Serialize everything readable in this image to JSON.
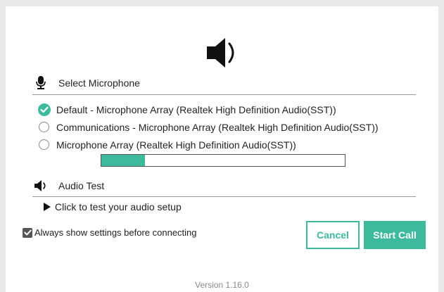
{
  "dialog": {
    "speaker_icon": "speaker-volume-icon"
  },
  "microphone": {
    "header": "Select Microphone",
    "icon": "microphone-icon",
    "options": [
      {
        "label": "Default - Microphone Array (Realtek High Definition Audio(SST))",
        "selected": true
      },
      {
        "label": "Communications - Microphone Array (Realtek High Definition Audio(SST))",
        "selected": false
      },
      {
        "label": "Microphone Array (Realtek High Definition Audio(SST))",
        "selected": false
      }
    ],
    "level": 0.18
  },
  "audio_test": {
    "header": "Audio Test",
    "icon": "speaker-icon",
    "test_link": "Click to test your audio setup"
  },
  "footer": {
    "always_show_label": "Always show settings before connecting",
    "always_show_checked": true,
    "cancel_label": "Cancel",
    "start_label": "Start Call",
    "version": "Version 1.16.0"
  },
  "colors": {
    "accent": "#3dba9c",
    "background": "#e9e9e9",
    "panel": "#ffffff"
  }
}
